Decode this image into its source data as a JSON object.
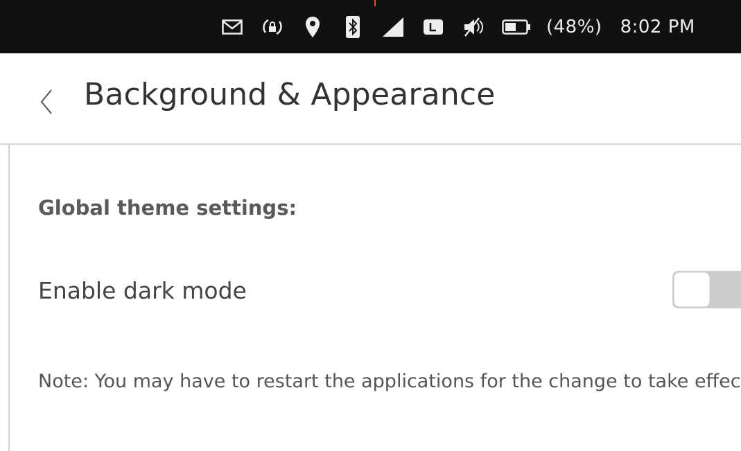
{
  "status_bar": {
    "icons": [
      "envelope-icon",
      "rotation-lock-icon",
      "location-pin-icon",
      "bluetooth-icon",
      "cellular-signal-icon",
      "lte-icon",
      "volume-muted-icon",
      "battery-icon"
    ],
    "battery_percent": "(48%)",
    "time": "8:02 PM",
    "accent_color": "#e95420"
  },
  "header": {
    "back_glyph": "〈",
    "title": "Background & Appearance"
  },
  "content": {
    "section_heading": "Global theme settings:",
    "dark_mode": {
      "label": "Enable dark mode",
      "enabled": false
    },
    "note": "Note: You may have to restart the applications for the change to take effect."
  }
}
